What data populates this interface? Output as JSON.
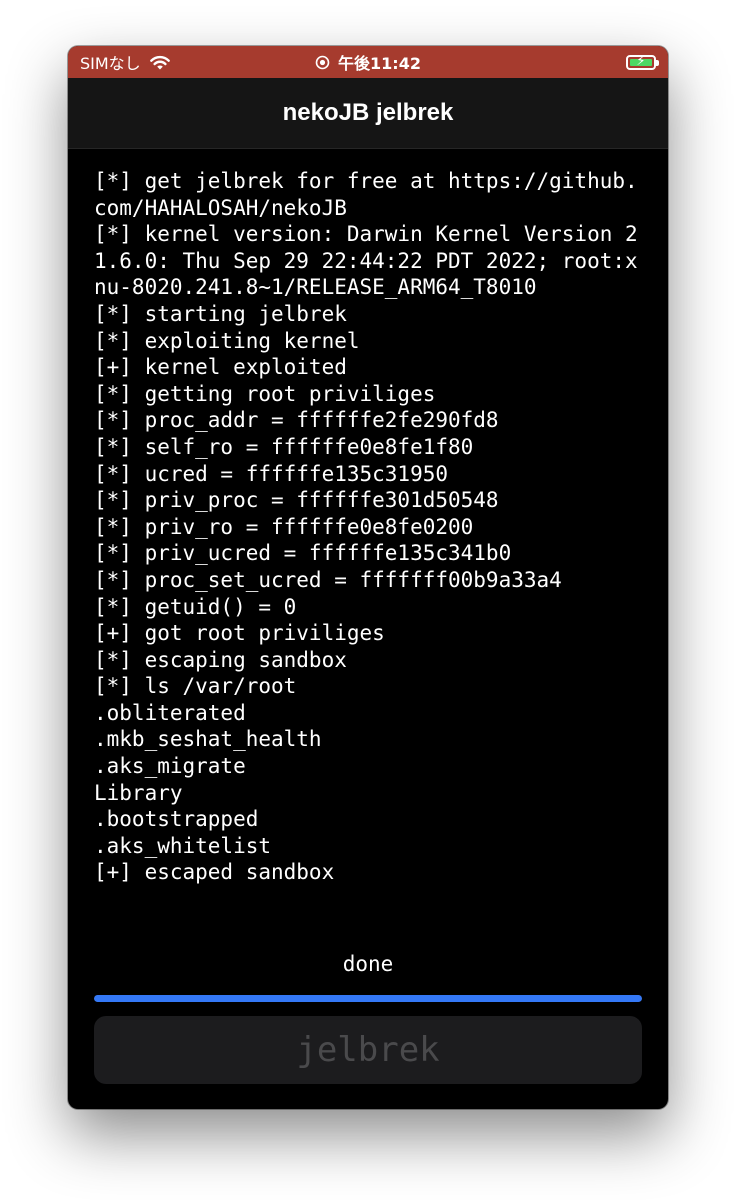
{
  "status_bar": {
    "carrier": "SIMなし",
    "wifi_icon": "wifi-icon",
    "location_icon": "location-icon",
    "time": "午後11:42",
    "battery_icon": "battery-charging-icon",
    "background_color": "#a63b2e"
  },
  "nav": {
    "title": "nekoJB jelbrek"
  },
  "log": {
    "lines": [
      "[*] get jelbrek for free at https://github.com/HAHALOSAH/nekoJB",
      "[*] kernel version: Darwin Kernel Version 21.6.0: Thu Sep 29 22:44:22 PDT 2022; root:xnu-8020.241.8~1/RELEASE_ARM64_T8010",
      "[*] starting jelbrek",
      "[*] exploiting kernel",
      "[+] kernel exploited",
      "[*] getting root priviliges",
      "[*] proc_addr = ffffffe2fe290fd8",
      "[*] self_ro = ffffffe0e8fe1f80",
      "[*] ucred = ffffffe135c31950",
      "[*] priv_proc = ffffffe301d50548",
      "[*] priv_ro = ffffffe0e8fe0200",
      "[*] priv_ucred = ffffffe135c341b0",
      "[*] proc_set_ucred = fffffff00b9a33a4",
      "[*] getuid() = 0",
      "[+] got root priviliges",
      "[*] escaping sandbox",
      "[*] ls /var/root",
      ".obliterated",
      ".mkb_seshat_health",
      ".aks_migrate",
      "Library",
      ".bootstrapped",
      ".aks_whitelist",
      "[+] escaped sandbox"
    ]
  },
  "status": {
    "text": "done"
  },
  "progress": {
    "value": 1.0,
    "color": "#3478f6"
  },
  "jelbrek_button": {
    "label": "jelbrek",
    "disabled": true
  }
}
